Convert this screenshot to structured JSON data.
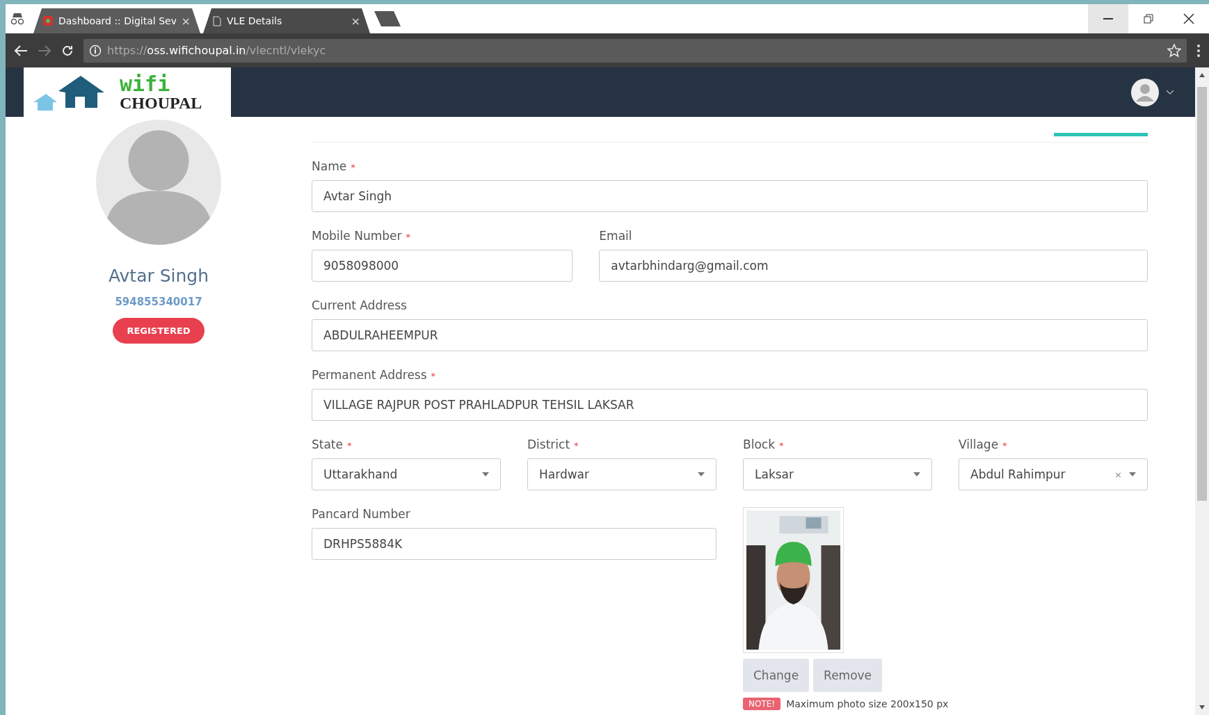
{
  "browser": {
    "tabs": [
      {
        "title": "Dashboard :: Digital Sev",
        "close": "×",
        "selected": false
      },
      {
        "title": "VLE Details",
        "close": "×",
        "selected": true
      }
    ],
    "url": {
      "scheme": "https://",
      "host": "oss.wifichoupal.in",
      "path": "/vlecntl/vlekyc"
    }
  },
  "logo": {
    "top": "wifi",
    "bottom": "CHOUPAL"
  },
  "profile": {
    "name": "Avtar Singh",
    "id": "594855340017",
    "status": "REGISTERED"
  },
  "form": {
    "fields": [
      {
        "kind": "text",
        "label": "Name",
        "mark": "*",
        "value": "Avtar Singh"
      },
      {
        "kind": "text",
        "label": "Mobile Number",
        "mark": "*",
        "value": "9058098000"
      },
      {
        "kind": "text",
        "label": "Email",
        "value": "avtarbhindarg@gmail.com"
      },
      {
        "kind": "text",
        "label": "Current Address",
        "value": "ABDULRAHEEMPUR"
      },
      {
        "kind": "text",
        "label": "Permanent Address",
        "mark": "*",
        "value": "VILLAGE RAJPUR POST PRAHLADPUR TEHSIL LAKSAR"
      },
      {
        "kind": "select",
        "label": "State",
        "mark": "*",
        "value": "Uttarakhand"
      },
      {
        "kind": "select",
        "label": "District",
        "mark": "*",
        "value": "Hardwar"
      },
      {
        "kind": "select",
        "label": "Block",
        "mark": "*",
        "value": "Laksar"
      },
      {
        "kind": "select",
        "label": "Village",
        "mark": "*",
        "value": "Abdul Rahimpur",
        "clear": "×"
      }
    ],
    "pancard": {
      "label": "Pancard Number",
      "value": "DRHPS5884K"
    },
    "photo": {
      "kind": "picture",
      "buttons": [
        "Change",
        "Remove"
      ],
      "note_badge": "NOTE!",
      "note": "Maximum photo size 200x150 px"
    }
  }
}
